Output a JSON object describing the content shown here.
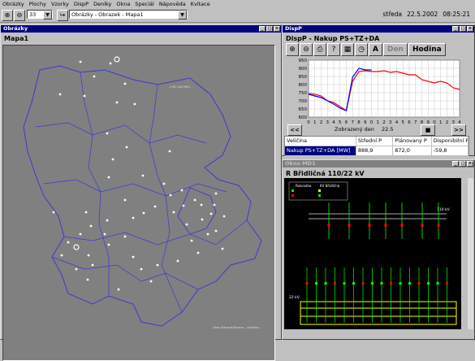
{
  "menu": [
    "Obrázky",
    "Plochy",
    "Vzorky",
    "DispP",
    "Deníky",
    "Okna",
    "Speciál",
    "Nápověda",
    "Kvitace"
  ],
  "toolbar": {
    "zoom_value": "33",
    "view_select": "Obrázky - Obrazek - Mapa1"
  },
  "clock": {
    "day": "středa",
    "date": "22.5.2002",
    "time": "08:25:21"
  },
  "map_window": {
    "title": "Obrázky",
    "tab": "Mapa1",
    "label_top": "2 NC Ústí MD1",
    "label_bottom": "Obec Březová/Morava - zkušební..."
  },
  "disp_window": {
    "title": "DispP",
    "heading": "DispP - Nakup PS+TZ+DA",
    "buttons": {
      "a": "A",
      "den": "Den",
      "hodina": "Hodina"
    },
    "nav": {
      "prev": "<<",
      "label": "Zobrazený den",
      "day": "22.5",
      "mid": "■",
      "next": ">>"
    },
    "table_headers": [
      "Veličina",
      "Střední P",
      "Plánovaný P",
      "Disponibilní P"
    ],
    "table_row": [
      "Nakup PS+TZ+DA [MW]",
      "888,9",
      "872,0",
      "-59,8"
    ]
  },
  "schema_window": {
    "title": "Okno MD1",
    "heading": "R Břidličná 110/22 kV",
    "legend1": "Rozvodna",
    "legend2": "KV Břidličná",
    "bus110": "110 kV",
    "bus22": "22 kV"
  },
  "chart_data": {
    "type": "line",
    "x": [
      0,
      1,
      2,
      3,
      4,
      5,
      6,
      7,
      8,
      9,
      10,
      11,
      12,
      13,
      14,
      15,
      16,
      17,
      18,
      19,
      20,
      21,
      22,
      23,
      24
    ],
    "ylim": [
      600,
      950
    ],
    "yticks": [
      600,
      650,
      700,
      750,
      800,
      850,
      900,
      950
    ],
    "series": [
      {
        "color": "#ff0000",
        "values": [
          745,
          740,
          730,
          700,
          690,
          665,
          640,
          820,
          880,
          885,
          880,
          880,
          885,
          875,
          880,
          870,
          860,
          860,
          830,
          820,
          810,
          820,
          810,
          780,
          770
        ]
      },
      {
        "color": "#0000ff",
        "values": [
          740,
          730,
          720,
          700,
          680,
          655,
          640,
          845,
          900,
          890,
          890,
          null,
          null,
          null,
          null,
          null,
          null,
          null,
          null,
          null,
          null,
          null,
          null,
          null,
          null
        ]
      }
    ],
    "grid": true
  },
  "colors": {
    "desktop": "#c0c0c0",
    "title_active": "#000080",
    "map_bg": "#808080",
    "map_border": "#3a3ad0"
  }
}
